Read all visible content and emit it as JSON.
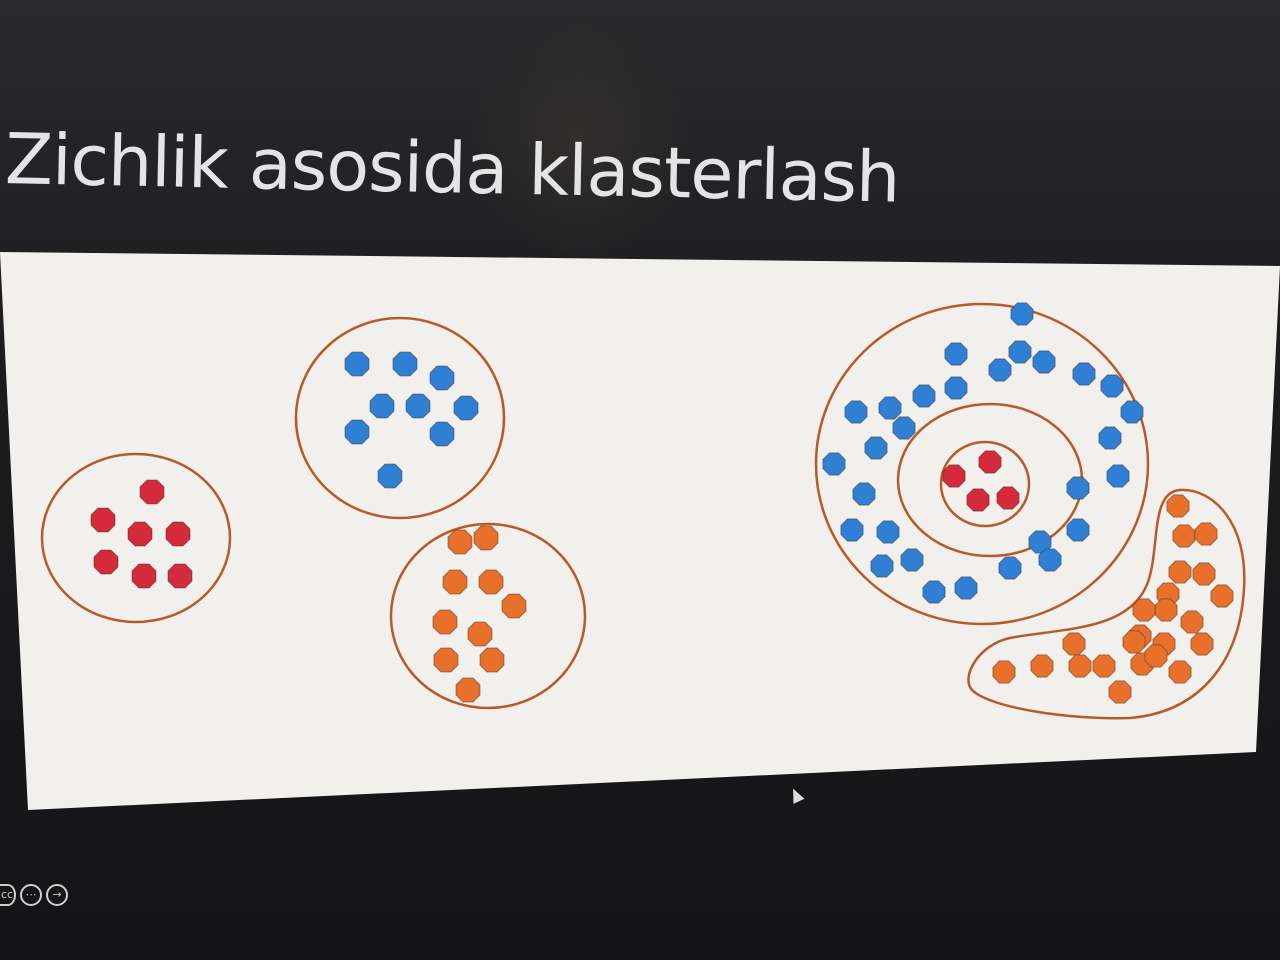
{
  "slide": {
    "title": "Zichlik asosida klasterlash"
  },
  "controls": [
    {
      "name": "captions-icon",
      "glyph": "cc"
    },
    {
      "name": "more-options-icon",
      "glyph": "⋯"
    },
    {
      "name": "next-slide-icon",
      "glyph": "→"
    }
  ],
  "colors": {
    "red": "#d42a3c",
    "blue": "#2f80d4",
    "orange": "#e8702a",
    "outline": "#b85a28",
    "panel": "#f1f0ec"
  }
}
